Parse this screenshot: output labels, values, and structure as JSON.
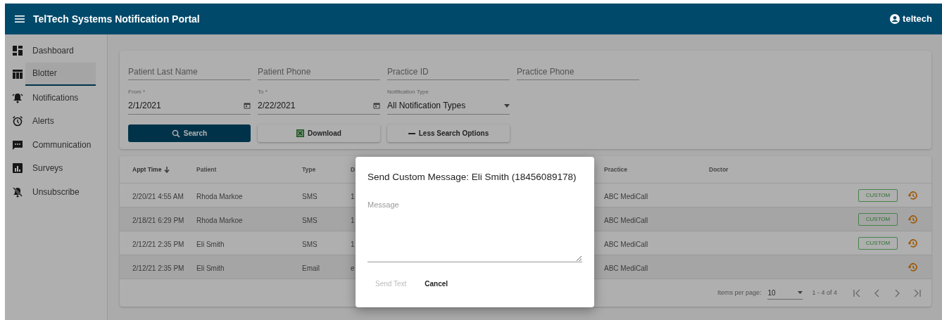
{
  "header": {
    "title": "TelTech Systems Notification Portal",
    "user": "teltech"
  },
  "sidebar": {
    "items": [
      {
        "kind": "dashboard",
        "label": "Dashboard",
        "selected": false
      },
      {
        "kind": "table",
        "label": "Blotter",
        "selected": true
      },
      {
        "kind": "bell",
        "label": "Notifications",
        "selected": false
      },
      {
        "kind": "alarm",
        "label": "Alerts",
        "selected": false
      },
      {
        "kind": "chat",
        "label": "Communication",
        "selected": false
      },
      {
        "kind": "chart",
        "label": "Surveys",
        "selected": false
      },
      {
        "kind": "mute",
        "label": "Unsubscribe",
        "selected": false
      }
    ]
  },
  "filters": {
    "text_fields": [
      {
        "placeholder": "Patient Last Name"
      },
      {
        "placeholder": "Patient Phone"
      },
      {
        "placeholder": "Practice ID"
      },
      {
        "placeholder": "Practice Phone"
      }
    ],
    "date_fields": [
      {
        "label": "From *",
        "value": "2/1/2021"
      },
      {
        "label": "To *",
        "value": "2/22/2021"
      }
    ],
    "select": {
      "label": "Notification Type",
      "value": "All Notification Types"
    },
    "buttons": [
      {
        "kind": "search",
        "label": "Search"
      },
      {
        "kind": "download",
        "label": "Download"
      },
      {
        "kind": "less",
        "label": "Less Search Options"
      }
    ]
  },
  "table": {
    "columns": [
      {
        "label": "Appt Time",
        "sorted": true
      },
      {
        "label": "Patient",
        "sorted": false
      },
      {
        "label": "Type",
        "sorted": false
      },
      {
        "label": "D",
        "sorted": false
      },
      {
        "label": "Practice",
        "sorted": false
      },
      {
        "label": "Doctor",
        "sorted": false
      }
    ],
    "rows": [
      {
        "cells": [
          "2/20/21 4:55 AM",
          "Rhoda Markoe",
          "SMS",
          "1",
          "ABC MediCall",
          ""
        ],
        "custom": "CUSTOM"
      },
      {
        "cells": [
          "2/18/21 6:29 PM",
          "Rhoda Markoe",
          "SMS",
          "1",
          "ABC MediCall",
          ""
        ],
        "custom": "CUSTOM"
      },
      {
        "cells": [
          "2/12/21 2:35 PM",
          "Eli Smith",
          "SMS",
          "1",
          "ABC MediCall",
          ""
        ],
        "custom": "CUSTOM"
      },
      {
        "cells": [
          "2/12/21 2:35 PM",
          "Eli Smith",
          "Email",
          "e",
          "ABC MediCall",
          ""
        ]
      }
    ]
  },
  "paginator": {
    "label": "Items per page:",
    "page_size": "10",
    "range": "1 - 4 of 4"
  },
  "dialog": {
    "title": "Send Custom Message: Eli Smith (18456089178)",
    "message_placeholder": "Message",
    "buttons": [
      {
        "label": "Send Text",
        "disabled": true
      },
      {
        "label": "Cancel",
        "disabled": false
      }
    ]
  }
}
